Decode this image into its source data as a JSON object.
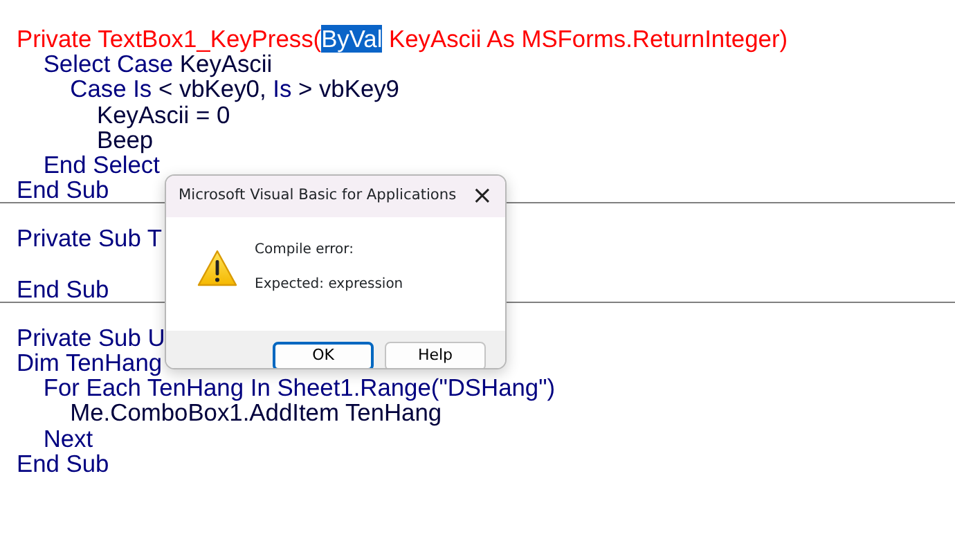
{
  "code_blocks": [
    {
      "lines": [
        {
          "error": true,
          "tokens": [
            {
              "text": "Private TextBox1_KeyPress(",
              "kind": "plain"
            },
            {
              "text": "ByVal",
              "kind": "selected"
            },
            {
              "text": " KeyAscii As MSForms.ReturnInteger)",
              "kind": "plain"
            }
          ]
        },
        {
          "error": false,
          "tokens": [
            {
              "text": "    Select Case",
              "kind": "keyword"
            },
            {
              "text": " KeyAscii",
              "kind": "plain"
            }
          ]
        },
        {
          "error": false,
          "tokens": [
            {
              "text": "        Case Is",
              "kind": "keyword"
            },
            {
              "text": " < vbKey0, ",
              "kind": "plain"
            },
            {
              "text": "Is",
              "kind": "keyword"
            },
            {
              "text": " > vbKey9",
              "kind": "plain"
            }
          ]
        },
        {
          "error": false,
          "tokens": [
            {
              "text": "            KeyAscii = 0",
              "kind": "plain"
            }
          ]
        },
        {
          "error": false,
          "tokens": [
            {
              "text": "            Beep",
              "kind": "plain"
            }
          ]
        },
        {
          "error": false,
          "tokens": [
            {
              "text": "    End Select",
              "kind": "keyword"
            }
          ]
        },
        {
          "error": false,
          "tokens": [
            {
              "text": "End Sub",
              "kind": "keyword"
            }
          ]
        }
      ]
    },
    {
      "lines": [
        {
          "error": false,
          "tokens": [
            {
              "text": "Private Sub",
              "kind": "keyword"
            },
            {
              "text": " T",
              "kind": "keyword"
            }
          ]
        },
        {
          "error": false,
          "tokens": [
            {
              "text": "End Sub",
              "kind": "keyword"
            }
          ]
        }
      ]
    },
    {
      "lines": [
        {
          "error": false,
          "tokens": [
            {
              "text": "Private Sub",
              "kind": "keyword"
            },
            {
              "text": " U",
              "kind": "keyword"
            }
          ]
        },
        {
          "error": false,
          "tokens": [
            {
              "text": "Dim",
              "kind": "keyword"
            },
            {
              "text": " TenHang",
              "kind": "keyword"
            }
          ]
        },
        {
          "error": false,
          "tokens": [
            {
              "text": "    For Each",
              "kind": "keyword"
            },
            {
              "text": " TenHang ",
              "kind": "keyword"
            },
            {
              "text": "In",
              "kind": "keyword"
            },
            {
              "text": " Sheet1.Range(\"DSHang\")",
              "kind": "keyword"
            }
          ]
        },
        {
          "error": false,
          "tokens": [
            {
              "text": "        Me.ComboBox1.AddItem TenHang",
              "kind": "plain"
            }
          ]
        },
        {
          "error": false,
          "tokens": [
            {
              "text": "    Next",
              "kind": "keyword"
            }
          ]
        },
        {
          "error": false,
          "tokens": [
            {
              "text": "End Sub",
              "kind": "keyword"
            }
          ]
        }
      ]
    }
  ],
  "dialog": {
    "title": "Microsoft Visual Basic for Applications",
    "close": "×",
    "messages": [
      "Compile error:",
      "Expected: expression"
    ],
    "buttons": [
      {
        "label": "OK",
        "default": true
      },
      {
        "label": "Help",
        "default": false
      }
    ]
  }
}
